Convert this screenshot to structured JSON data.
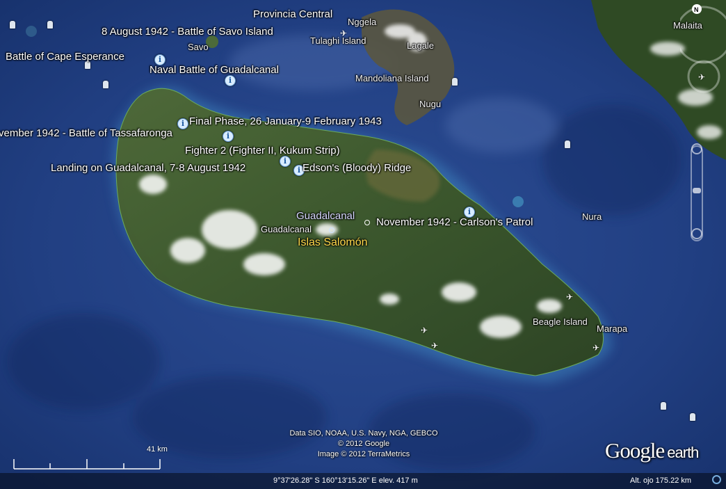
{
  "map": {
    "colors": {
      "ocean": "#1f3a7a",
      "land": "#39502a",
      "cloud": "#ffffff",
      "label_highlight": "#ffd84a"
    },
    "battle_labels": [
      "8 August 1942 - Battle of Savo Island",
      "Battle of Cape Esperance",
      "Naval Battle of Guadalcanal",
      "Final Phase, 26 January-9 February 1943",
      "vember 1942 - Battle of Tassafaronga",
      "Fighter 2 (Fighter II, Kukum Strip)",
      "Landing on Guadalcanal, 7-8 August 1942",
      "Edson's (Bloody) Ridge",
      "November 1942 - Carlson's Patrol"
    ],
    "place_labels": [
      "Provincia Central",
      "Nggela",
      "Savo",
      "Tulaghi Island",
      "Lagale",
      "Mandoliana Island",
      "Nugu",
      "Malaita",
      "Guadalcanal",
      "Guadalcanal",
      "Nura",
      "Beagle Island",
      "Marapa"
    ],
    "country_label": "Islas Salomón",
    "info_icon": "i"
  },
  "attribution": {
    "line1": "Data SIO, NOAA, U.S. Navy, NGA, GEBCO",
    "line2": "© 2012 Google",
    "line3": "Image © 2012 TerraMetrics"
  },
  "logo": {
    "google": "Google",
    "earth": "earth"
  },
  "scale": {
    "label": "41 km"
  },
  "status": {
    "coordinates": "9°37'26.28\" S  160°13'15.26\" E elev.   417 m",
    "eye_alt": "Alt. ojo    175.22 km"
  },
  "nav": {
    "north": "N"
  }
}
